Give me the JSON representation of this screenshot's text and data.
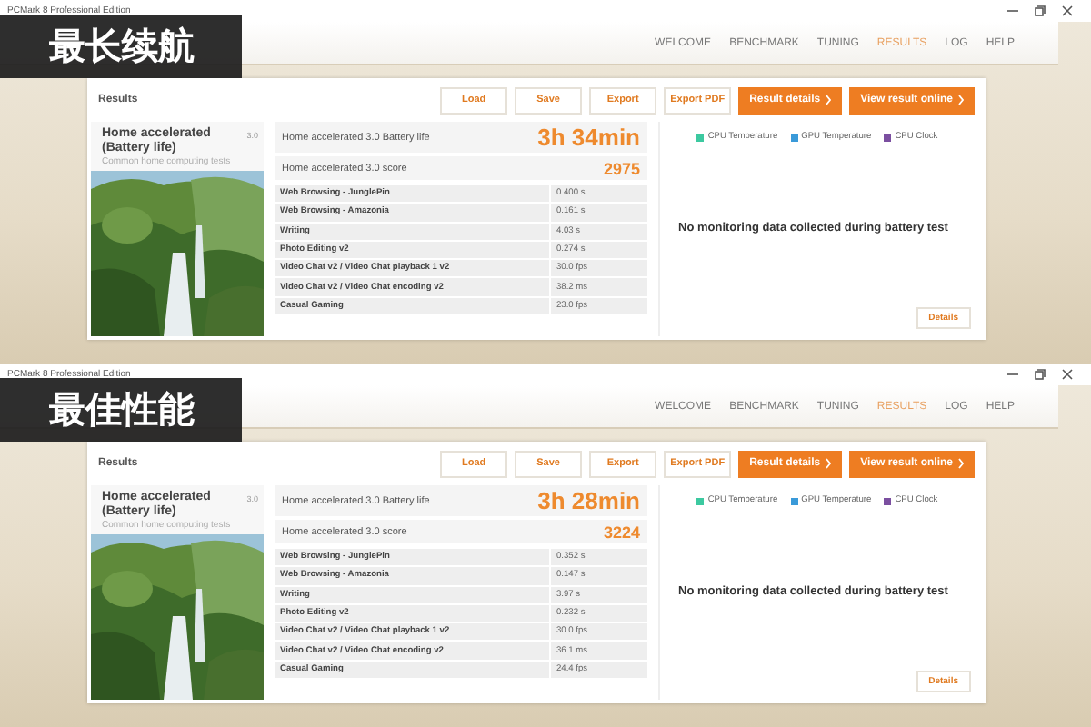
{
  "panels": [
    {
      "overlay_label": "最长续航",
      "window": {
        "title": "PCMark 8 Professional Edition"
      },
      "nav": [
        {
          "label": "WELCOME",
          "selected": false
        },
        {
          "label": "BENCHMARK",
          "selected": false
        },
        {
          "label": "TUNING",
          "selected": false
        },
        {
          "label": "RESULTS",
          "selected": true
        },
        {
          "label": "LOG",
          "selected": false
        },
        {
          "label": "HELP",
          "selected": false
        }
      ],
      "results_heading": "Results",
      "toolbar": [
        {
          "label": "Load",
          "kind": "plain"
        },
        {
          "label": "Save",
          "kind": "plain"
        },
        {
          "label": "Export",
          "kind": "plain"
        },
        {
          "label": "Export PDF",
          "kind": "plain"
        },
        {
          "label": "Result details",
          "kind": "primary"
        },
        {
          "label": "View result online",
          "kind": "primary"
        }
      ],
      "benchmark": {
        "title": "Home accelerated (Battery life)",
        "version": "3.0",
        "subtitle": "Common home computing tests"
      },
      "battery_life": {
        "label": "Home accelerated 3.0 Battery life",
        "value": "3h 34min"
      },
      "score": {
        "label": "Home accelerated 3.0 score",
        "value": "2975"
      },
      "tests": [
        {
          "name": "Web Browsing - JunglePin",
          "result": "0.400 s"
        },
        {
          "name": "Web Browsing - Amazonia",
          "result": "0.161 s"
        },
        {
          "name": "Writing",
          "result": "4.03 s"
        },
        {
          "name": "Photo Editing v2",
          "result": "0.274 s"
        },
        {
          "name": "Video Chat v2 / Video Chat playback 1 v2",
          "result": "30.0 fps"
        },
        {
          "name": "Video Chat v2 / Video Chat encoding v2",
          "result": "38.2 ms"
        },
        {
          "name": "Casual Gaming",
          "result": "23.0 fps"
        }
      ],
      "legend": [
        {
          "label": "CPU Temperature",
          "color": "#3cc9a0"
        },
        {
          "label": "GPU Temperature",
          "color": "#3a9ad9"
        },
        {
          "label": "CPU Clock",
          "color": "#7b4fa0"
        }
      ],
      "message": "No monitoring data collected during battery test",
      "details_button": "Details"
    },
    {
      "overlay_label": "最佳性能",
      "window": {
        "title": "PCMark 8 Professional Edition"
      },
      "nav": [
        {
          "label": "WELCOME",
          "selected": false
        },
        {
          "label": "BENCHMARK",
          "selected": false
        },
        {
          "label": "TUNING",
          "selected": false
        },
        {
          "label": "RESULTS",
          "selected": true
        },
        {
          "label": "LOG",
          "selected": false
        },
        {
          "label": "HELP",
          "selected": false
        }
      ],
      "results_heading": "Results",
      "toolbar": [
        {
          "label": "Load",
          "kind": "plain"
        },
        {
          "label": "Save",
          "kind": "plain"
        },
        {
          "label": "Export",
          "kind": "plain"
        },
        {
          "label": "Export PDF",
          "kind": "plain"
        },
        {
          "label": "Result details",
          "kind": "primary"
        },
        {
          "label": "View result online",
          "kind": "primary"
        }
      ],
      "benchmark": {
        "title": "Home accelerated (Battery life)",
        "version": "3.0",
        "subtitle": "Common home computing tests"
      },
      "battery_life": {
        "label": "Home accelerated 3.0 Battery life",
        "value": "3h 28min"
      },
      "score": {
        "label": "Home accelerated 3.0 score",
        "value": "3224"
      },
      "tests": [
        {
          "name": "Web Browsing - JunglePin",
          "result": "0.352 s"
        },
        {
          "name": "Web Browsing - Amazonia",
          "result": "0.147 s"
        },
        {
          "name": "Writing",
          "result": "3.97 s"
        },
        {
          "name": "Photo Editing v2",
          "result": "0.232 s"
        },
        {
          "name": "Video Chat v2 / Video Chat playback 1 v2",
          "result": "30.0 fps"
        },
        {
          "name": "Video Chat v2 / Video Chat encoding v2",
          "result": "36.1 ms"
        },
        {
          "name": "Casual Gaming",
          "result": "24.4 fps"
        }
      ],
      "legend": [
        {
          "label": "CPU Temperature",
          "color": "#3cc9a0"
        },
        {
          "label": "GPU Temperature",
          "color": "#3a9ad9"
        },
        {
          "label": "CPU Clock",
          "color": "#7b4fa0"
        }
      ],
      "message": "No monitoring data collected during battery test",
      "details_button": "Details"
    }
  ]
}
